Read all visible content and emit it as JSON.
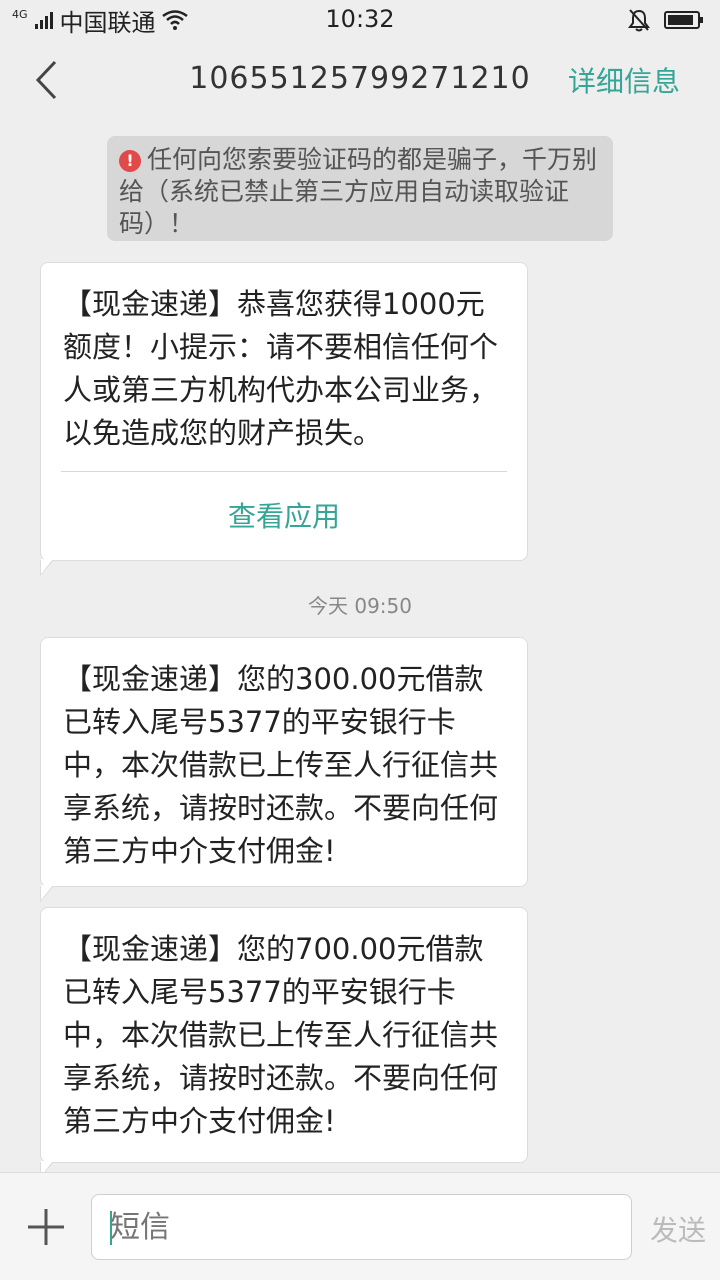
{
  "status": {
    "network_type": "4G",
    "carrier": "中国联通",
    "time": "10:32"
  },
  "header": {
    "title": "10655125799271210",
    "detail_label": "详细信息"
  },
  "warning": {
    "text": "任何向您索要验证码的都是骗子，千万别给（系统已禁止第三方应用自动读取验证码）！"
  },
  "messages": [
    {
      "text": "【现金速递】恭喜您获得1000元额度！小提示：请不要相信任何个人或第三方机构代办本公司业务，以免造成您的财产损失。",
      "action_label": "查看应用"
    },
    {
      "text": "【现金速递】您的300.00元借款已转入尾号5377的平安银行卡中，本次借款已上传至人行征信共享系统，请按时还款。不要向任何第三方中介支付佣金!"
    },
    {
      "text": "【现金速递】您的700.00元借款已转入尾号5377的平安银行卡中，本次借款已上传至人行征信共享系统，请按时还款。不要向任何第三方中介支付佣金!"
    }
  ],
  "timestamp": "今天  09:50",
  "input": {
    "placeholder": "短信",
    "send_label": "发送"
  },
  "colors": {
    "accent": "#35a596",
    "warning_red": "#e14a4a"
  }
}
